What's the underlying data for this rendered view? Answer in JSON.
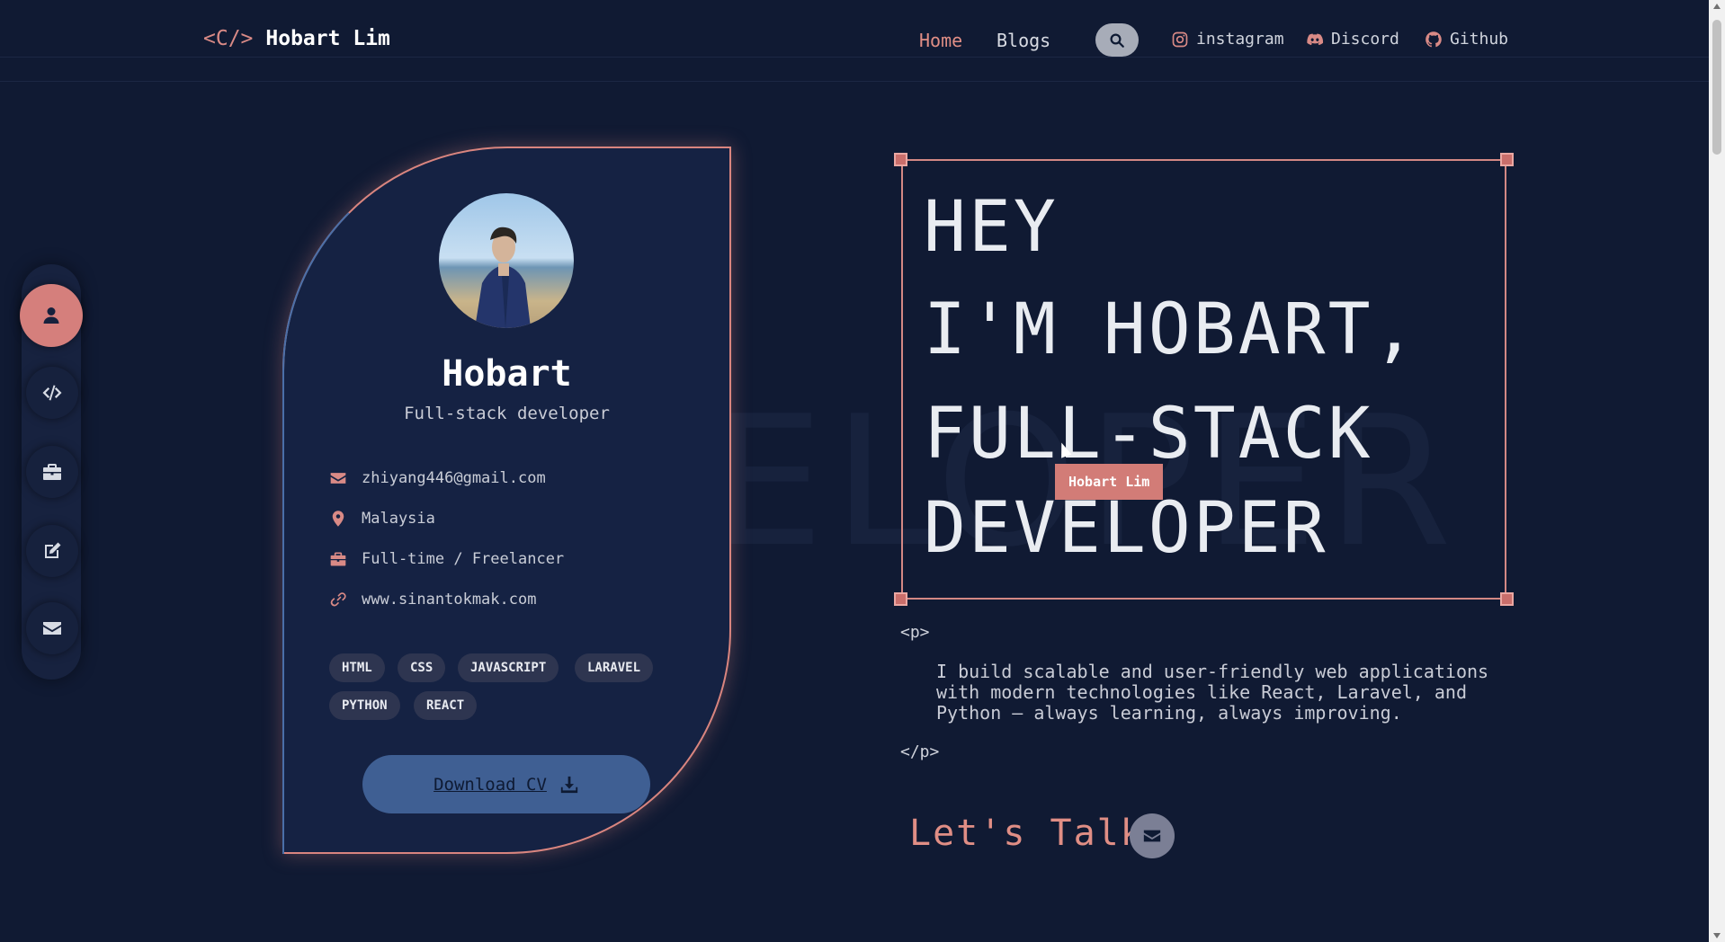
{
  "header": {
    "logo_bracket": "<C/>",
    "logo_name": "Hobart Lim",
    "nav": [
      "Home",
      "Blogs"
    ],
    "active_nav": "Home",
    "socials": [
      {
        "label": "instagram",
        "icon": "instagram-icon"
      },
      {
        "label": "Discord",
        "icon": "discord-icon"
      },
      {
        "label": "Github",
        "icon": "github-icon"
      }
    ]
  },
  "sidebar": {
    "items": [
      {
        "icon": "user-icon",
        "active": true
      },
      {
        "icon": "code-icon",
        "active": false
      },
      {
        "icon": "briefcase-icon",
        "active": false
      },
      {
        "icon": "edit-icon",
        "active": false
      },
      {
        "icon": "envelope-icon",
        "active": false
      }
    ]
  },
  "profile": {
    "name": "Hobart",
    "role": "Full-stack developer",
    "info": [
      {
        "icon": "envelope-icon",
        "text": "zhiyang446@gmail.com"
      },
      {
        "icon": "map-pin-icon",
        "text": "Malaysia"
      },
      {
        "icon": "briefcase-icon",
        "text": "Full-time / Freelancer"
      },
      {
        "icon": "link-icon",
        "text": "www.sinantokmak.com"
      }
    ],
    "tags": [
      "HTML",
      "CSS",
      "JAVASCRIPT",
      "LARAVEL",
      "PYTHON",
      "REACT"
    ],
    "cv_label": "Download CV"
  },
  "hero": {
    "watermark": "ELOPER",
    "lines": [
      "HEY",
      "I'M HOBART,",
      "FULL-STACK",
      "DEVELOPER"
    ],
    "tooltip": "Hobart Lim",
    "p_open": "<p>",
    "p_close": "</p>",
    "description": "I build scalable and user-friendly web applications with modern technologies like React, Laravel, and Python — always learning, always improving.",
    "talk_label": "Let's Talk"
  },
  "colors": {
    "background": "#101a33",
    "accent": "#d98a86",
    "card": "#152243",
    "cv_button": "#3f5f93"
  }
}
